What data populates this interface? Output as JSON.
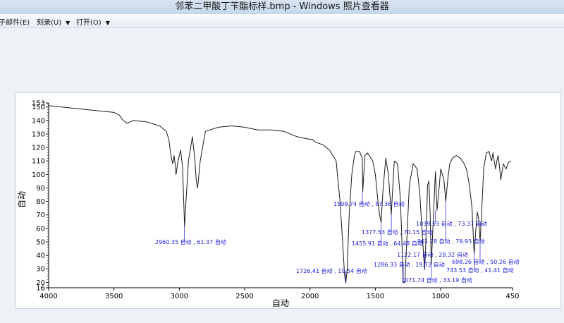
{
  "window": {
    "title": "邻苯二甲酸丁苄酯标样.bmp - Windows 照片查看器"
  },
  "menu": {
    "items": [
      {
        "label": "子邮件(E)",
        "has_arrow": false
      },
      {
        "label": "刻录(U)",
        "has_arrow": true
      },
      {
        "label": "打开(O)",
        "has_arrow": true
      }
    ],
    "arrow_glyph": "▼"
  },
  "colors": {
    "trace": "#1a1a1a",
    "annotation": "#1a1adf",
    "background": "#eef2f7"
  },
  "chart_data": {
    "type": "line",
    "xlabel": "自动",
    "ylabel": "自动",
    "xlim": [
      4000,
      450
    ],
    "ylim": [
      16,
      153
    ],
    "x_ticks": [
      4000,
      3500,
      3000,
      2500,
      2000,
      1500,
      1000,
      450
    ],
    "y_ticks": [
      16,
      20,
      30,
      40,
      50,
      60,
      70,
      80,
      90,
      100,
      110,
      120,
      130,
      140,
      150,
      153
    ],
    "series": [
      {
        "x": [
          4000,
          3900,
          3700,
          3600,
          3500,
          3460,
          3430,
          3400,
          3350,
          3250,
          3150,
          3100,
          3080,
          3070,
          3060,
          3050,
          3040,
          3030,
          3025,
          3010,
          2990,
          2975,
          2960,
          2950,
          2930,
          2900,
          2880,
          2870,
          2860,
          2840,
          2800,
          2700,
          2600,
          2500,
          2400,
          2300,
          2200,
          2100,
          2050,
          2000,
          1980,
          1960,
          1900,
          1850,
          1800,
          1790,
          1770,
          1750,
          1735,
          1726,
          1715,
          1700,
          1680,
          1660,
          1650,
          1620,
          1600,
          1596,
          1580,
          1560,
          1520,
          1500,
          1480,
          1470,
          1456,
          1440,
          1420,
          1400,
          1385,
          1378,
          1370,
          1355,
          1330,
          1310,
          1300,
          1287,
          1275,
          1260,
          1240,
          1210,
          1180,
          1160,
          1140,
          1123,
          1115,
          1100,
          1090,
          1080,
          1072,
          1060,
          1040,
          1028,
          1010,
          1000,
          990,
          975,
          961,
          945,
          930,
          910,
          880,
          850,
          820,
          800,
          780,
          760,
          744,
          740,
          730,
          720,
          710,
          698,
          690,
          670,
          650,
          630,
          610,
          600,
          590,
          580,
          570,
          560,
          550,
          540,
          520,
          500,
          480,
          460
        ],
        "y": [
          151,
          150,
          148,
          147,
          146,
          144,
          140,
          138,
          140,
          139,
          136,
          132,
          126,
          118,
          112,
          108,
          114,
          106,
          100,
          110,
          118,
          105,
          61.37,
          78,
          110,
          128,
          110,
          95,
          90,
          110,
          132,
          135,
          136,
          135,
          133,
          133,
          132,
          128,
          127,
          126,
          126,
          124,
          122,
          118,
          110,
          100,
          80,
          50,
          25,
          19.54,
          30,
          70,
          100,
          114,
          117,
          117,
          112,
          87.36,
          114,
          116,
          110,
          100,
          80,
          72,
          64.48,
          90,
          112,
          100,
          80,
          70.15,
          85,
          110,
          108,
          84,
          60,
          19.72,
          20,
          50,
          92,
          108,
          104,
          86,
          54,
          29.32,
          45,
          92,
          95,
          70,
          33.19,
          58,
          102,
          73.37,
          92,
          104,
          101,
          96,
          79.93,
          97,
          108,
          112,
          114,
          112,
          108,
          103,
          92,
          75,
          41.41,
          45,
          60,
          72,
          68,
          50.26,
          65,
          105,
          116,
          117,
          110,
          116,
          110,
          104,
          110,
          114,
          106,
          96,
          108,
          104,
          109,
          110
        ]
      }
    ],
    "peaks": [
      {
        "x": 2960.35,
        "y": 61.37,
        "label": "2960.35 自动 , 61.37 自动"
      },
      {
        "x": 1726.41,
        "y": 19.54,
        "label": "1726.41 自动 , 19.54 自动"
      },
      {
        "x": 1599.74,
        "y": 87.36,
        "label": "1599.74 自动 , 87.36 自动"
      },
      {
        "x": 1377.53,
        "y": 70.15,
        "label": "1377.53 自动 , 70.15 自动"
      },
      {
        "x": 1455.91,
        "y": 64.48,
        "label": "1455.91 自动 , 64.48 自动"
      },
      {
        "x": 1286.33,
        "y": 19.72,
        "label": "1286.33 自动 , 19.72 自动"
      },
      {
        "x": 1122.17,
        "y": 29.32,
        "label": "1122.17 自动 , 29.32 自动"
      },
      {
        "x": 1071.74,
        "y": 33.19,
        "label": "1071.74 自动 , 33.19 自动"
      },
      {
        "x": 1039.53,
        "y": 73.37,
        "label": "1039.53 自动 , 73.37 自动"
      },
      {
        "x": 961.78,
        "y": 79.93,
        "label": "961.78 自动 , 79.93 自动"
      },
      {
        "x": 698.26,
        "y": 50.26,
        "label": "698.26 自动 , 50.26 自动"
      },
      {
        "x": 743.53,
        "y": 41.41,
        "label": "743.53 自动 , 41.41 自动"
      }
    ]
  }
}
